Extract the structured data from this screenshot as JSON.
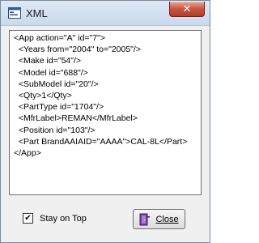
{
  "window": {
    "title": "XML"
  },
  "xml_lines": [
    "<App action=\"A\" id=\"7\">",
    "  <Years from=\"2004\" to=\"2005\"/>",
    "  <Make id=\"54\"/>",
    "  <Model id=\"688\"/>",
    "  <SubModel id=\"20\"/>",
    "  <Qty>1</Qty>",
    "  <PartType id=\"1704\"/>",
    "  <MfrLabel>REMAN</MfrLabel>",
    "  <Position id=\"103\"/>",
    "  <Part BrandAAIAID=\"AAAA\">CAL-8L</Part>",
    "</App>"
  ],
  "stay_on_top": {
    "label": "Stay on Top",
    "checked": true
  },
  "close_button": {
    "label": "Close",
    "icon": "door-exit-icon"
  },
  "titlebar_close": {
    "glyph": "✕",
    "icon": "close-icon"
  }
}
